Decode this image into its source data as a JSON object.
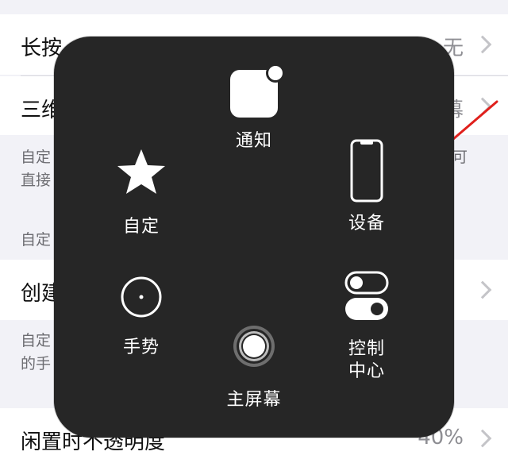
{
  "settings": {
    "row_long_press": {
      "label": "长按",
      "value": "无"
    },
    "row_3d_touch": {
      "label": "三维",
      "value": "幕"
    },
    "desc_custom": {
      "line1": "自定",
      "line2": "直接",
      "trailing": "可"
    },
    "section_custom_label": "自定",
    "row_create": {
      "label": "创建"
    },
    "desc_gesture": {
      "line1": "自定",
      "line2": "的手"
    },
    "row_idle_opacity": {
      "label": "闲置时不透明度",
      "value": "40%"
    }
  },
  "menu": {
    "notification": {
      "label": "通知",
      "icon": "notification-icon"
    },
    "custom": {
      "label": "自定",
      "icon": "star-icon"
    },
    "device": {
      "label": "设备",
      "icon": "phone-icon"
    },
    "gesture": {
      "label": "手势",
      "icon": "gesture-icon"
    },
    "control_center": {
      "label_line1": "控制",
      "label_line2": "中心",
      "icon": "toggle-switches-icon"
    },
    "home": {
      "label": "主屏幕",
      "icon": "home-button-icon"
    }
  },
  "annotation": {
    "arrow_color": "#e0201c"
  }
}
